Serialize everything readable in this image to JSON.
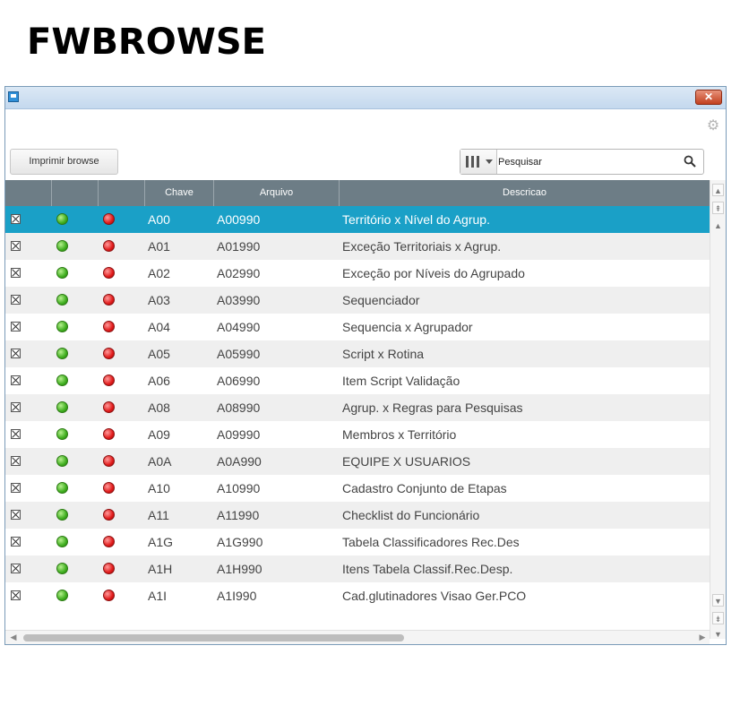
{
  "page_title": "FWBROWSE",
  "window": {
    "close_symbol": "✕",
    "settings_icon": "gear-icon"
  },
  "toolbar": {
    "print_label": "Imprimir browse",
    "search_value": "Pesquisar"
  },
  "table": {
    "columns": [
      "",
      "",
      "",
      "Chave",
      "Arquivo",
      "Descricao"
    ],
    "rows": [
      {
        "chave": "A00",
        "arquivo": "A00990",
        "descricao": "Território x Nível do Agrup."
      },
      {
        "chave": "A01",
        "arquivo": "A01990",
        "descricao": "Exceção Territoriais x Agrup."
      },
      {
        "chave": "A02",
        "arquivo": "A02990",
        "descricao": "Exceção por Níveis do Agrupado"
      },
      {
        "chave": "A03",
        "arquivo": "A03990",
        "descricao": "Sequenciador"
      },
      {
        "chave": "A04",
        "arquivo": "A04990",
        "descricao": "Sequencia x Agrupador"
      },
      {
        "chave": "A05",
        "arquivo": "A05990",
        "descricao": "Script x Rotina"
      },
      {
        "chave": "A06",
        "arquivo": "A06990",
        "descricao": "Item Script Validação"
      },
      {
        "chave": "A08",
        "arquivo": "A08990",
        "descricao": "Agrup. x Regras para Pesquisas"
      },
      {
        "chave": "A09",
        "arquivo": "A09990",
        "descricao": "Membros x Território"
      },
      {
        "chave": "A0A",
        "arquivo": "A0A990",
        "descricao": "EQUIPE X USUARIOS"
      },
      {
        "chave": "A10",
        "arquivo": "A10990",
        "descricao": "Cadastro Conjunto de Etapas"
      },
      {
        "chave": "A11",
        "arquivo": "A11990",
        "descricao": "Checklist do Funcionário"
      },
      {
        "chave": "A1G",
        "arquivo": "A1G990",
        "descricao": "Tabela Classificadores Rec.Des"
      },
      {
        "chave": "A1H",
        "arquivo": "A1H990",
        "descricao": "Itens Tabela Classif.Rec.Desp."
      },
      {
        "chave": "A1I",
        "arquivo": "A1I990",
        "descricao": "Cad.glutinadores Visao Ger.PCO"
      }
    ],
    "selected_index": 0
  },
  "colors": {
    "header_bg": "#6d7d86",
    "selected_row": "#1aa0c7",
    "status_green": "#3fae1f",
    "status_red": "#e11a1a"
  }
}
